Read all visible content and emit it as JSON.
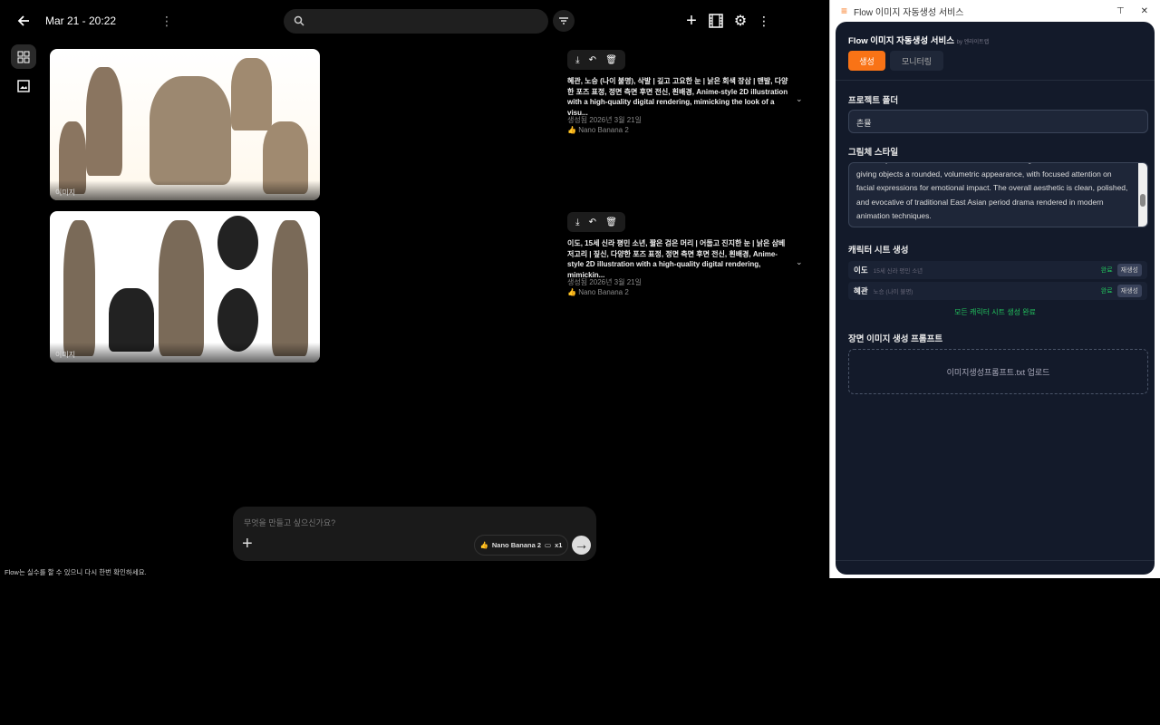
{
  "header": {
    "title": "Mar 21 - 20:22",
    "search_placeholder": ""
  },
  "items": [
    {
      "image_label": "이미지",
      "description": "혜관, 노승 (나이 불명), 삭발 | 깊고 고요한 눈 | 낡은 회색 장삼 | 맨발, 다양한 포즈 표정, 정면 측면 후면 전신, 흰배경, Anime-style 2D illustration with a high-quality digital rendering, mimicking the look of a visu...",
      "created": "생성됨 2026년 3월 21일",
      "model": "Nano Banana 2"
    },
    {
      "image_label": "이미지",
      "description": "이도, 15세 신라 평민 소년, 짧은 검은 머리 | 어둡고 진지한 눈 | 낡은 삼베 저고리 | 짚신, 다양한 포즈 표정, 정면 측면 후면 전신, 흰배경, Anime-style 2D illustration with a high-quality digital rendering, mimickin...",
      "created": "생성됨 2026년 3월 21일",
      "model": "Nano Banana 2"
    }
  ],
  "prompt": {
    "placeholder": "무엇을 만들고 싶으신가요?",
    "model": "Nano Banana 2",
    "count": "x1"
  },
  "disclaimer": "Flow는 실수를 할 수 있으니 다시 한번 확인하세요.",
  "panel": {
    "window_title": "Flow 이미지 자동생성 서비스",
    "app_title_bold": "Flow",
    "app_title": " 이미지 자동생성 서비스",
    "by": "by 엔라이트랩",
    "tabs": [
      "생성",
      "모니터링"
    ],
    "project_folder_label": "프로젝트 폴더",
    "project_folder_value": "촌뮬",
    "style_label": "그림체 스타일",
    "style_text": "anime style and minimal texture detail. The shading is soft and airbrushed, giving objects a rounded, volumetric appearance, with focused attention on facial expressions for emotional impact. The overall aesthetic is clean, polished, and evocative of traditional East Asian period drama rendered in modern animation techniques.",
    "character_label": "캐릭터 시트 생성",
    "characters": [
      {
        "name": "이도",
        "desc": "15세 신라 평민 소년",
        "status": "완료",
        "action": "재생성"
      },
      {
        "name": "혜관",
        "desc": "노승 (나이 불명)",
        "status": "완료",
        "action": "재생성"
      }
    ],
    "all_done": "모든 캐릭터 시트 생성 완료",
    "scene_label": "장면 이미지 생성 프롬프트",
    "upload": "이미지생성프롬프트.txt 업로드",
    "accent": "#f97316"
  }
}
